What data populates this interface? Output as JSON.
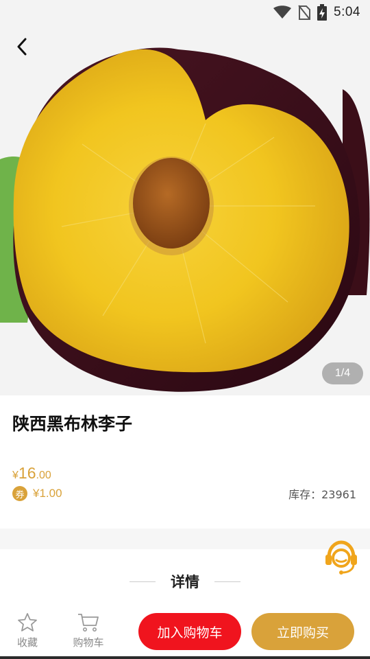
{
  "status_bar": {
    "time": "5:04",
    "icons": [
      "wifi-icon",
      "no-sim-icon",
      "battery-charging-icon"
    ]
  },
  "header": {
    "back_icon": "back-chevron-icon"
  },
  "gallery": {
    "pager": "1/4"
  },
  "product": {
    "title": "陕西黑布林李子",
    "price_symbol": "¥",
    "price_int": "16",
    "price_dec": ".00",
    "coupon_badge": "券",
    "coupon_value": "¥1.00",
    "stock": "库存：23961"
  },
  "details": {
    "heading": "详情"
  },
  "support": {
    "icon": "customer-service-icon"
  },
  "bottom_bar": {
    "favorite_label": "收藏",
    "cart_label": "购物车",
    "add_to_cart": "加入购物车",
    "buy_now": "立即购买"
  },
  "colors": {
    "accent_gold": "#d9a23a",
    "accent_red": "#f0141e"
  }
}
